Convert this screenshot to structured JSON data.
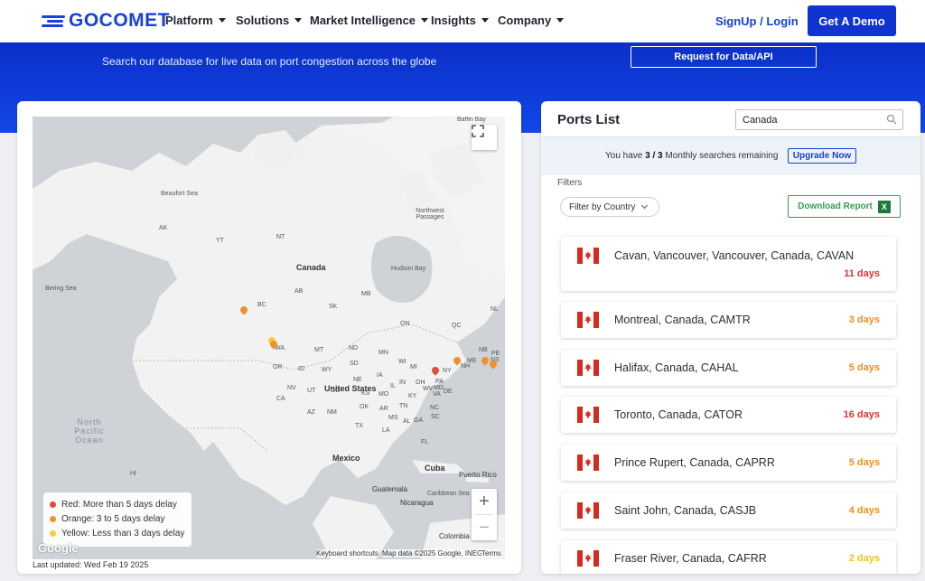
{
  "header": {
    "logo_text": "GOCOMET",
    "nav": [
      {
        "label": "Platform"
      },
      {
        "label": "Solutions"
      },
      {
        "label": "Market Intelligence"
      },
      {
        "label": "Insights"
      },
      {
        "label": "Company"
      }
    ],
    "signup_label": "SignUp / Login",
    "demo_label": "Get A Demo"
  },
  "hero": {
    "tagline": "Search our database for live data on port congestion across the globe",
    "api_button": "Request for Data/API"
  },
  "map": {
    "country_labels": [
      "Canada",
      "United States",
      "Mexico",
      "Cuba",
      "Guatemala",
      "Nicaragua",
      "Colombia",
      "Puerto Rico"
    ],
    "region_labels": [
      "AK",
      "YT",
      "NT",
      "BC",
      "AB",
      "SK",
      "MB",
      "ON",
      "QC",
      "NL",
      "WA",
      "OR",
      "ID",
      "MT",
      "ND",
      "MN",
      "WI",
      "MI",
      "NY",
      "ME",
      "NB",
      "NS",
      "PE",
      "NH",
      "PA",
      "OH",
      "IN",
      "IL",
      "IA",
      "NE",
      "SD",
      "WY",
      "NV",
      "UT",
      "CO",
      "KS",
      "MO",
      "KY",
      "WV",
      "VA",
      "NC",
      "TN",
      "AR",
      "OK",
      "NM",
      "AZ",
      "CA",
      "TX",
      "LA",
      "MS",
      "AL",
      "GA",
      "SC",
      "FL",
      "MD",
      "DE",
      "HI"
    ],
    "water_labels": [
      "Baffin Bay",
      "Hudson Bay",
      "Beaufort Sea",
      "Northwest Passages",
      "Bering Sea",
      "North Pacific Ocean",
      "Caribbean Sea"
    ],
    "legend": [
      {
        "label": "Red: More than 5 days delay",
        "color": "#e04b3c"
      },
      {
        "label": "Orange: 3 to 5 days delay",
        "color": "#f0922b"
      },
      {
        "label": "Yellow: Less than 3 days delay",
        "color": "#f5cf3b"
      }
    ],
    "zoom_in": "+",
    "zoom_out": "−",
    "google_logo": "Google",
    "keyboard_shortcuts": "Keyboard shortcuts",
    "map_data": "Map data ©2025 Google, INEGI",
    "terms": "Terms",
    "last_updated": "Last updated: Wed Feb 19 2025"
  },
  "ports": {
    "title": "Ports List",
    "search_value": "Canada",
    "quota_prefix": "You have ",
    "quota_value": "3 / 3",
    "quota_suffix": " Monthly searches remaining",
    "upgrade_label": "Upgrade Now",
    "filters_label": "Filters",
    "filter_country": "Filter by Country",
    "download_label": "Download Report",
    "xls_icon_letter": "X",
    "items": [
      {
        "name": "Cavan, Vancouver, Vancouver, Canada, CAVAN",
        "days": "11 days",
        "color": "#d9362b"
      },
      {
        "name": "Montreal, Canada, CAMTR",
        "days": "3 days",
        "color": "#ef8f1a"
      },
      {
        "name": "Halifax, Canada, CAHAL",
        "days": "5 days",
        "color": "#ef8f1a"
      },
      {
        "name": "Toronto, Canada, CATOR",
        "days": "16 days",
        "color": "#d9362b"
      },
      {
        "name": "Prince Rupert, Canada, CAPRR",
        "days": "5 days",
        "color": "#ef8f1a"
      },
      {
        "name": "Saint John, Canada, CASJB",
        "days": "4 days",
        "color": "#ef8f1a"
      },
      {
        "name": "Fraser River, Canada, CAFRR",
        "days": "2 days",
        "color": "#f0c419"
      }
    ]
  }
}
